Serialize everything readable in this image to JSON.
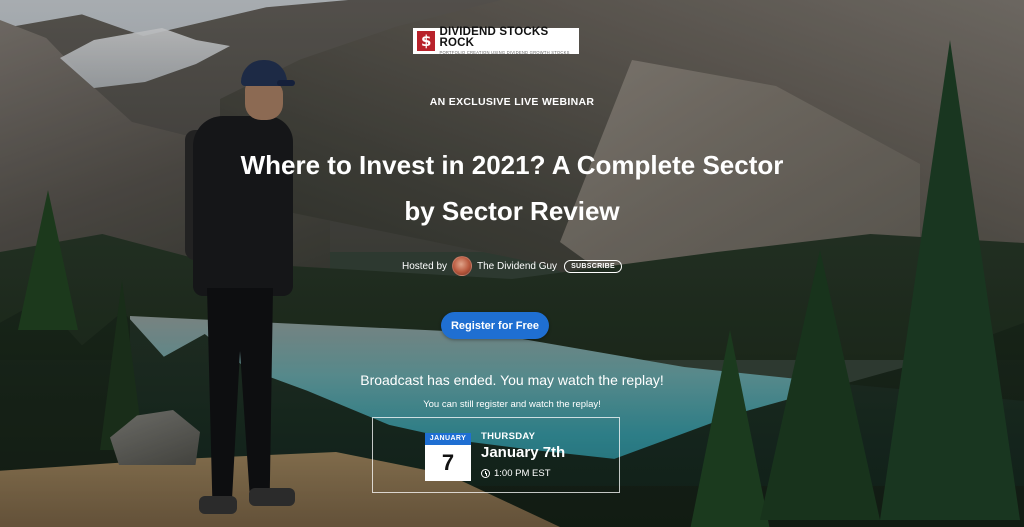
{
  "brand": {
    "badge": "$",
    "name": "DIVIDEND STOCKS ROCK",
    "tagline": "PORTFOLIO CREATION USING DIVIDEND GROWTH STOCKS",
    "accent": "#b8222b"
  },
  "hero": {
    "eyebrow": "AN EXCLUSIVE LIVE WEBINAR",
    "title_line1": "Where to Invest in 2021? A Complete Sector",
    "title_line2": "by Sector Review"
  },
  "host": {
    "prefix": "Hosted by",
    "name": "The Dividend Guy",
    "subscribe_label": "SUBSCRIBE"
  },
  "cta": {
    "register_label": "Register for Free",
    "color": "#1f6fd2"
  },
  "status": {
    "ended": "Broadcast has ended. You may watch the replay!",
    "still_register": "You can still register and watch the replay!"
  },
  "event": {
    "month": "JANUARY",
    "day": "7",
    "weekday": "THURSDAY",
    "date": "January 7th",
    "time": "1:00 PM EST",
    "icon": "clock-icon"
  }
}
